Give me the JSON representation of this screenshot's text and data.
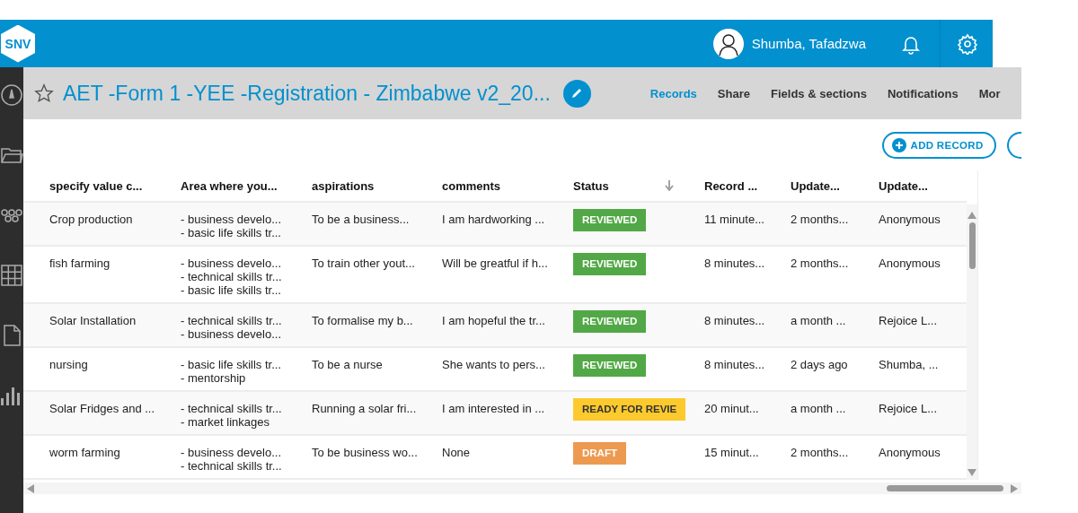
{
  "topbar": {
    "logo": "SNV",
    "user": "Shumba, Tafadzwa"
  },
  "form": {
    "title": "AET -Form 1 -YEE -Registration - Zimbabwe v2_20...",
    "favorite": false
  },
  "tabs": [
    {
      "label": "Records",
      "selected": true
    },
    {
      "label": "Share",
      "selected": false
    },
    {
      "label": "Fields & sections",
      "selected": false
    },
    {
      "label": "Notifications",
      "selected": false
    },
    {
      "label": "Mor",
      "selected": false
    }
  ],
  "add_button": "ADD RECORD",
  "table": {
    "columns": [
      "specify value c...",
      "Area where you...",
      "aspirations",
      "comments",
      "Status",
      "Record ...",
      "Update...",
      "Update..."
    ],
    "rows": [
      {
        "value_chain": "Crop production",
        "area": [
          "- business develo...",
          "- basic life skills tr..."
        ],
        "aspirations": "To be a business...",
        "comments": "I am hardworking ...",
        "status": {
          "label": "REVIEWED",
          "color": "#52a846"
        },
        "record": "11 minute...",
        "updated": "2 months...",
        "updated_by": "Anonymous"
      },
      {
        "value_chain": "fish farming",
        "area": [
          "- business develo...",
          "- technical skills tr...",
          "- basic life skills tr..."
        ],
        "aspirations": "To train other yout...",
        "comments": "Will be greatful if h...",
        "status": {
          "label": "REVIEWED",
          "color": "#52a846"
        },
        "record": "8 minutes...",
        "updated": "2 months...",
        "updated_by": "Anonymous"
      },
      {
        "value_chain": "Solar Installation",
        "area": [
          "- technical skills tr...",
          "- business develo..."
        ],
        "aspirations": "To formalise my b...",
        "comments": "I am hopeful the tr...",
        "status": {
          "label": "REVIEWED",
          "color": "#52a846"
        },
        "record": "8 minutes...",
        "updated": "a month ...",
        "updated_by": "Rejoice L..."
      },
      {
        "value_chain": "nursing",
        "area": [
          "- basic life skills tr...",
          "- mentorship"
        ],
        "aspirations": "To be a nurse",
        "comments": "She wants to pers...",
        "status": {
          "label": "REVIEWED",
          "color": "#52a846"
        },
        "record": "8 minutes...",
        "updated": "2 days ago",
        "updated_by": "Shumba, ..."
      },
      {
        "value_chain": "Solar Fridges and ...",
        "area": [
          "- technical skills tr...",
          "- market linkages"
        ],
        "aspirations": "Running a solar fri...",
        "comments": "I am interested in ...",
        "status": {
          "label": "READY FOR REVIE",
          "color": "#fdca2e"
        },
        "record": "20 minut...",
        "updated": "a month ...",
        "updated_by": "Rejoice L..."
      },
      {
        "value_chain": "worm farming",
        "area": [
          "- business develo...",
          "- technical skills tr..."
        ],
        "aspirations": "To be business wo...",
        "comments": "None",
        "status": {
          "label": "DRAFT",
          "color": "#ed9a50"
        },
        "record": "15 minut...",
        "updated": "2 months...",
        "updated_by": "Anonymous"
      }
    ]
  }
}
